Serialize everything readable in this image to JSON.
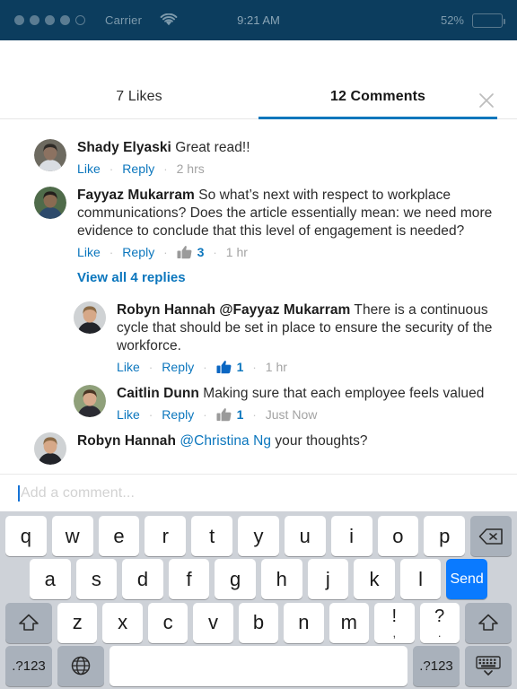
{
  "statusbar": {
    "carrier": "Carrier",
    "time": "9:21 AM",
    "battery_pct": "52%",
    "battery_level": 52,
    "signal_dots_filled": 4,
    "signal_dots_total": 5,
    "wifi_icon": "wifi-icon",
    "bg_color": "#0c3d5e"
  },
  "sheet": {
    "close_icon": "close-icon"
  },
  "tabs": [
    {
      "label": "7 Likes",
      "active": false
    },
    {
      "label": "12 Comments",
      "active": true
    }
  ],
  "accent_color": "#0a77bc",
  "link_color": "#0b76bd",
  "send_color": "#0a7aff",
  "actions": {
    "like": "Like",
    "reply": "Reply",
    "separator": "·"
  },
  "comments": [
    {
      "author": "Shady Elyaski",
      "mention": "",
      "mention_style": "",
      "text": "Great read!!",
      "like_label": "Like",
      "reply_label": "Reply",
      "like_count": "",
      "liked": false,
      "timestamp": "2 hrs",
      "indent": false,
      "avatar": "avatar-shady"
    },
    {
      "author": "Fayyaz Mukarram",
      "mention": "",
      "mention_style": "",
      "text": "So what’s next with respect to workplace communications? Does the article essentially mean: we need more evidence to conclude that this level of engagement is needed?",
      "like_label": "Like",
      "reply_label": "Reply",
      "like_count": "3",
      "liked": false,
      "timestamp": "1 hr",
      "indent": false,
      "avatar": "avatar-fayyaz"
    },
    {
      "author": "Robyn Hannah",
      "mention": "@Fayyaz Mukarram",
      "mention_style": "bold",
      "text": "There is a continuous cycle that should be set in place to ensure the security of the workforce.",
      "like_label": "Like",
      "reply_label": "Reply",
      "like_count": "1",
      "liked": true,
      "timestamp": "1 hr",
      "indent": true,
      "avatar": "avatar-robyn"
    },
    {
      "author": "Caitlin Dunn",
      "mention": "",
      "mention_style": "",
      "text": "Making sure that each employee feels valued",
      "like_label": "Like",
      "reply_label": "Reply",
      "like_count": "1",
      "liked": false,
      "timestamp": "Just Now",
      "indent": true,
      "avatar": "avatar-caitlin"
    },
    {
      "author": "Robyn Hannah",
      "mention": "@Christina Ng",
      "mention_style": "link",
      "text": "your thoughts?",
      "like_label": "",
      "reply_label": "",
      "like_count": "",
      "liked": false,
      "timestamp": "",
      "indent": false,
      "avatar": "avatar-robyn"
    }
  ],
  "view_replies": "View all 4 replies",
  "composer": {
    "placeholder": "Add a comment...",
    "value": ""
  },
  "keyboard": {
    "row1": [
      "q",
      "w",
      "e",
      "r",
      "t",
      "y",
      "u",
      "i",
      "o",
      "p"
    ],
    "backspace_icon": "backspace-icon",
    "row2": [
      "a",
      "s",
      "d",
      "f",
      "g",
      "h",
      "j",
      "k",
      "l"
    ],
    "send_label": "Send",
    "row3": [
      "z",
      "x",
      "c",
      "v",
      "b",
      "n",
      "m"
    ],
    "shift_icon": "shift-icon",
    "punct1_top": "!",
    "punct1_bottom": ",",
    "punct2_top": "?",
    "punct2_bottom": ".",
    "numeric_label": ".?123",
    "globe_icon": "globe-icon",
    "space_label": "",
    "dismiss_icon": "dismiss-keyboard-icon"
  }
}
